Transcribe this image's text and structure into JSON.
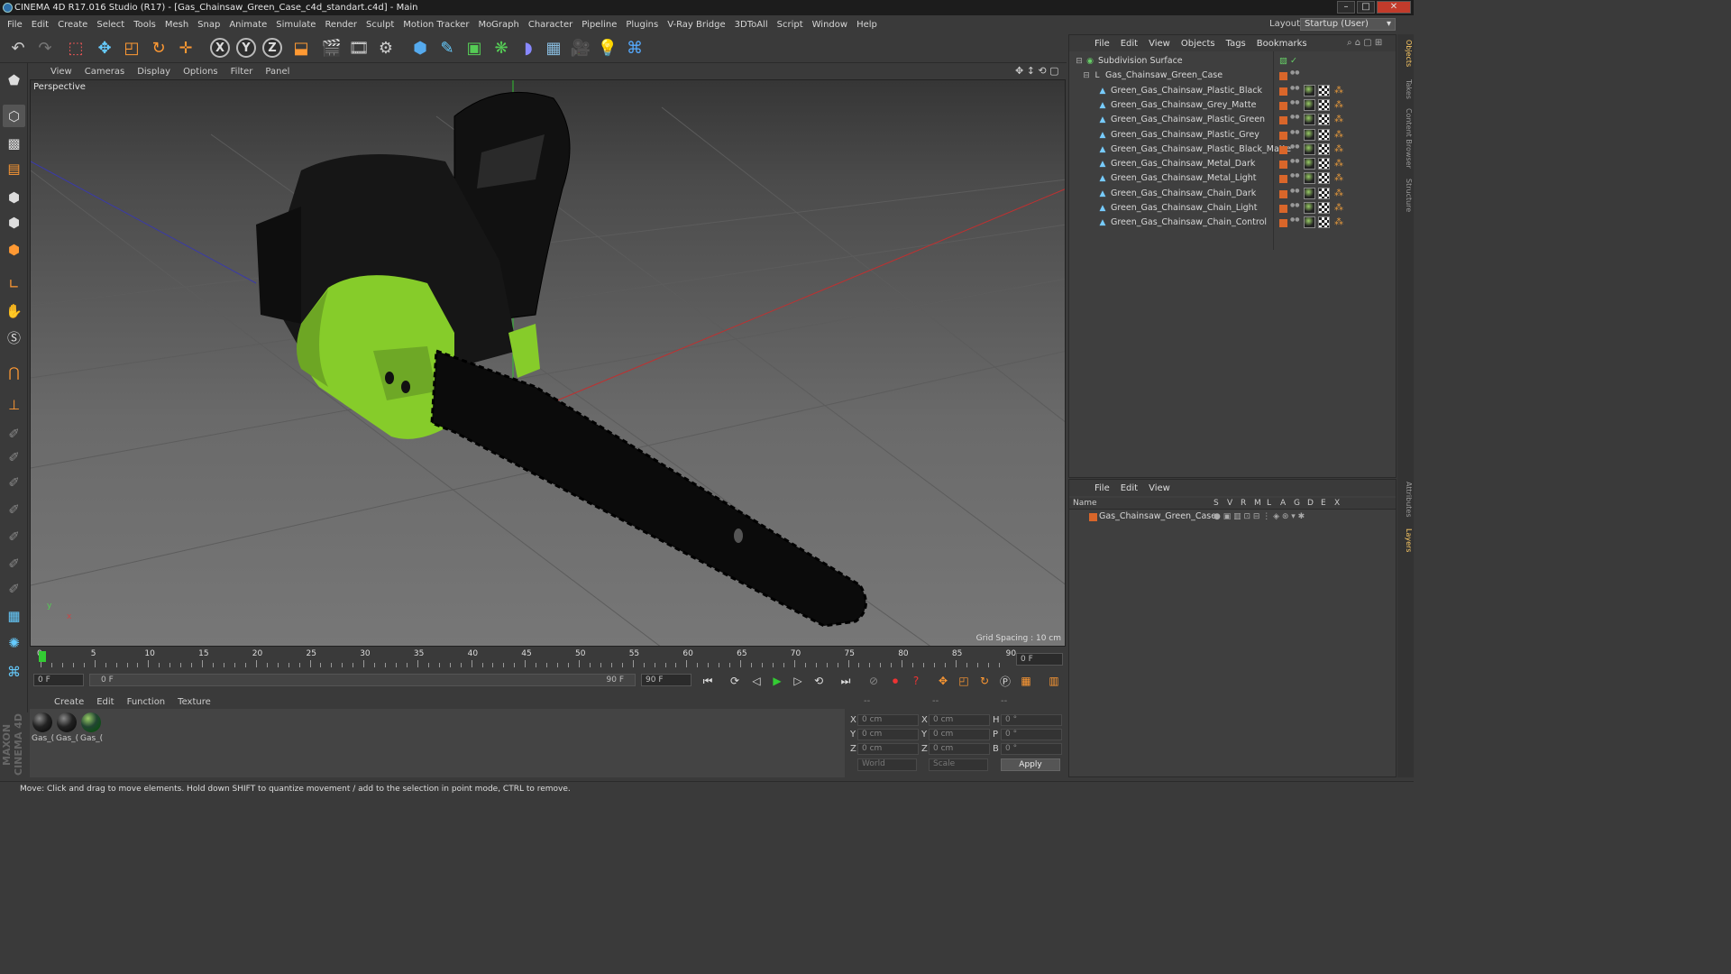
{
  "window": {
    "title": "CINEMA 4D R17.016 Studio (R17) - [Gas_Chainsaw_Green_Case_c4d_standart.c4d] - Main",
    "buttons": [
      "minimize",
      "maximize",
      "close"
    ]
  },
  "menubar": [
    "File",
    "Edit",
    "Create",
    "Select",
    "Tools",
    "Mesh",
    "Snap",
    "Animate",
    "Simulate",
    "Render",
    "Sculpt",
    "Motion Tracker",
    "MoGraph",
    "Character",
    "Pipeline",
    "Plugins",
    "V-Ray Bridge",
    "3DToAll",
    "Script",
    "Window",
    "Help"
  ],
  "layout": {
    "label": "Layout:",
    "value": "Startup (User)"
  },
  "viewport": {
    "menu": [
      "View",
      "Cameras",
      "Display",
      "Options",
      "Filter",
      "Panel"
    ],
    "label": "Perspective",
    "grid_spacing": "Grid Spacing : 10 cm",
    "axis": {
      "x": "x",
      "y": "y"
    }
  },
  "timeline": {
    "ticks": [
      "0",
      "5",
      "10",
      "15",
      "20",
      "25",
      "30",
      "35",
      "40",
      "45",
      "50",
      "55",
      "60",
      "65",
      "70",
      "75",
      "80",
      "85",
      "90"
    ],
    "current_frame_right": "0 F",
    "start": "0 F",
    "range_start": "0 F",
    "range_end": "90 F",
    "end": "90 F"
  },
  "material_manager": {
    "menu": [
      "Create",
      "Edit",
      "Function",
      "Texture"
    ],
    "materials": [
      "Gas_(",
      "Gas_(",
      "Gas_("
    ]
  },
  "coordinates": {
    "headers": [
      "--",
      "--",
      "--"
    ],
    "rows": [
      {
        "a": "X",
        "av": "0 cm",
        "b": "X",
        "bv": "0 cm",
        "c": "H",
        "cv": "0 °"
      },
      {
        "a": "Y",
        "av": "0 cm",
        "b": "Y",
        "bv": "0 cm",
        "c": "P",
        "cv": "0 °"
      },
      {
        "a": "Z",
        "av": "0 cm",
        "b": "Z",
        "bv": "0 cm",
        "c": "B",
        "cv": "0 °"
      }
    ],
    "mode": "World",
    "transform": "Scale",
    "apply": "Apply"
  },
  "object_manager": {
    "menu": [
      "File",
      "Edit",
      "View",
      "Objects",
      "Tags",
      "Bookmarks"
    ],
    "objects": [
      {
        "name": "Subdivision Surface",
        "level": 0
      },
      {
        "name": "Gas_Chainsaw_Green_Case",
        "level": 1
      },
      {
        "name": "Green_Gas_Chainsaw_Plastic_Black",
        "level": 2
      },
      {
        "name": "Green_Gas_Chainsaw_Grey_Matte",
        "level": 2
      },
      {
        "name": "Green_Gas_Chainsaw_Plastic_Green",
        "level": 2
      },
      {
        "name": "Green_Gas_Chainsaw_Plastic_Grey",
        "level": 2
      },
      {
        "name": "Green_Gas_Chainsaw_Plastic_Black_Matte",
        "level": 2
      },
      {
        "name": "Green_Gas_Chainsaw_Metal_Dark",
        "level": 2
      },
      {
        "name": "Green_Gas_Chainsaw_Metal_Light",
        "level": 2
      },
      {
        "name": "Green_Gas_Chainsaw_Chain_Dark",
        "level": 2
      },
      {
        "name": "Green_Gas_Chainsaw_Chain_Light",
        "level": 2
      },
      {
        "name": "Green_Gas_Chainsaw_Chain_Control",
        "level": 2
      }
    ]
  },
  "layer_manager": {
    "menu": [
      "File",
      "Edit",
      "View"
    ],
    "columns": [
      "Name",
      "S",
      "V",
      "R",
      "M",
      "L",
      "A",
      "G",
      "D",
      "E",
      "X"
    ],
    "layers": [
      "Gas_Chainsaw_Green_Case"
    ]
  },
  "right_tabs": [
    "Objects",
    "Takes",
    "Content Browser",
    "Structure",
    "Attributes",
    "Layers"
  ],
  "status": "Move: Click and drag to move elements. Hold down SHIFT to quantize movement / add to the selection in point mode, CTRL to remove.",
  "brand": "MAXON CINEMA 4D",
  "colors": {
    "accent_green": "#9be22d",
    "object_tag": "#d9662a",
    "bg": "#3a3a3a"
  }
}
